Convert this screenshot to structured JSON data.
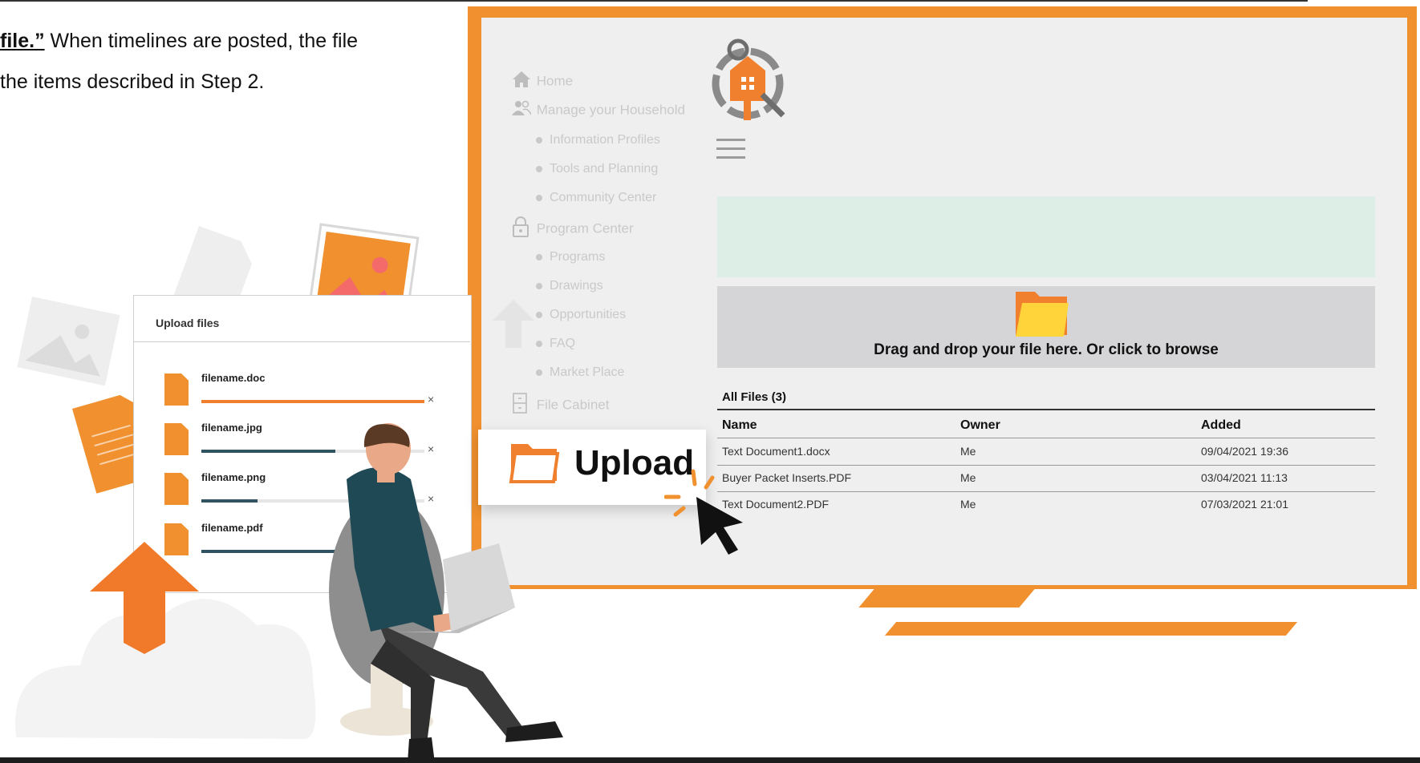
{
  "intro": {
    "line1_bold": "file.”",
    "line1_rest": " When timelines are posted, the file",
    "line2": "the items described in Step 2."
  },
  "sidebar": {
    "items": [
      {
        "label": "Home",
        "icon": "home-icon",
        "type": "top"
      },
      {
        "label": "Manage your Household",
        "icon": "users-icon",
        "type": "top"
      },
      {
        "label": "Information Profiles",
        "type": "sub"
      },
      {
        "label": "Tools and Planning",
        "type": "sub"
      },
      {
        "label": "Community Center",
        "type": "sub"
      },
      {
        "label": "Program Center",
        "icon": "lock-icon",
        "type": "top"
      },
      {
        "label": "Programs",
        "type": "sub"
      },
      {
        "label": "Drawings",
        "type": "sub"
      },
      {
        "label": "Opportunities",
        "type": "sub"
      },
      {
        "label": "FAQ",
        "type": "sub"
      },
      {
        "label": "Market Place",
        "type": "sub"
      },
      {
        "label": "File Cabinet",
        "icon": "cabinet-icon",
        "type": "top"
      }
    ]
  },
  "dropzone": {
    "text": "Drag and drop your file here. Or click to browse"
  },
  "files": {
    "heading": "All Files (3)",
    "columns": [
      "Name",
      "Owner",
      "Added"
    ],
    "rows": [
      [
        "Text Document1.docx",
        "Me",
        "09/04/2021 19:36"
      ],
      [
        "Buyer Packet Inserts.PDF",
        "Me",
        "03/04/2021 11:13"
      ],
      [
        "Text Document2.PDF",
        "Me",
        "07/03/2021 21:01"
      ]
    ]
  },
  "upload_panel": {
    "title": "Upload files",
    "files": [
      {
        "name": "filename.doc",
        "progress": 1.0,
        "color": "#f0802e"
      },
      {
        "name": "filename.jpg",
        "progress": 0.6,
        "color": "#2f5360"
      },
      {
        "name": "filename.png",
        "progress": 0.25,
        "color": "#2f5360"
      },
      {
        "name": "filename.pdf",
        "progress": 0.75,
        "color": "#2f5360"
      }
    ],
    "close_glyph": "×"
  },
  "upload_button": {
    "label": "Upload"
  },
  "colors": {
    "accent": "#f0902e",
    "screen": "#efefef",
    "dropzone": "#d5d5d7",
    "banner": "#ddeee7"
  }
}
